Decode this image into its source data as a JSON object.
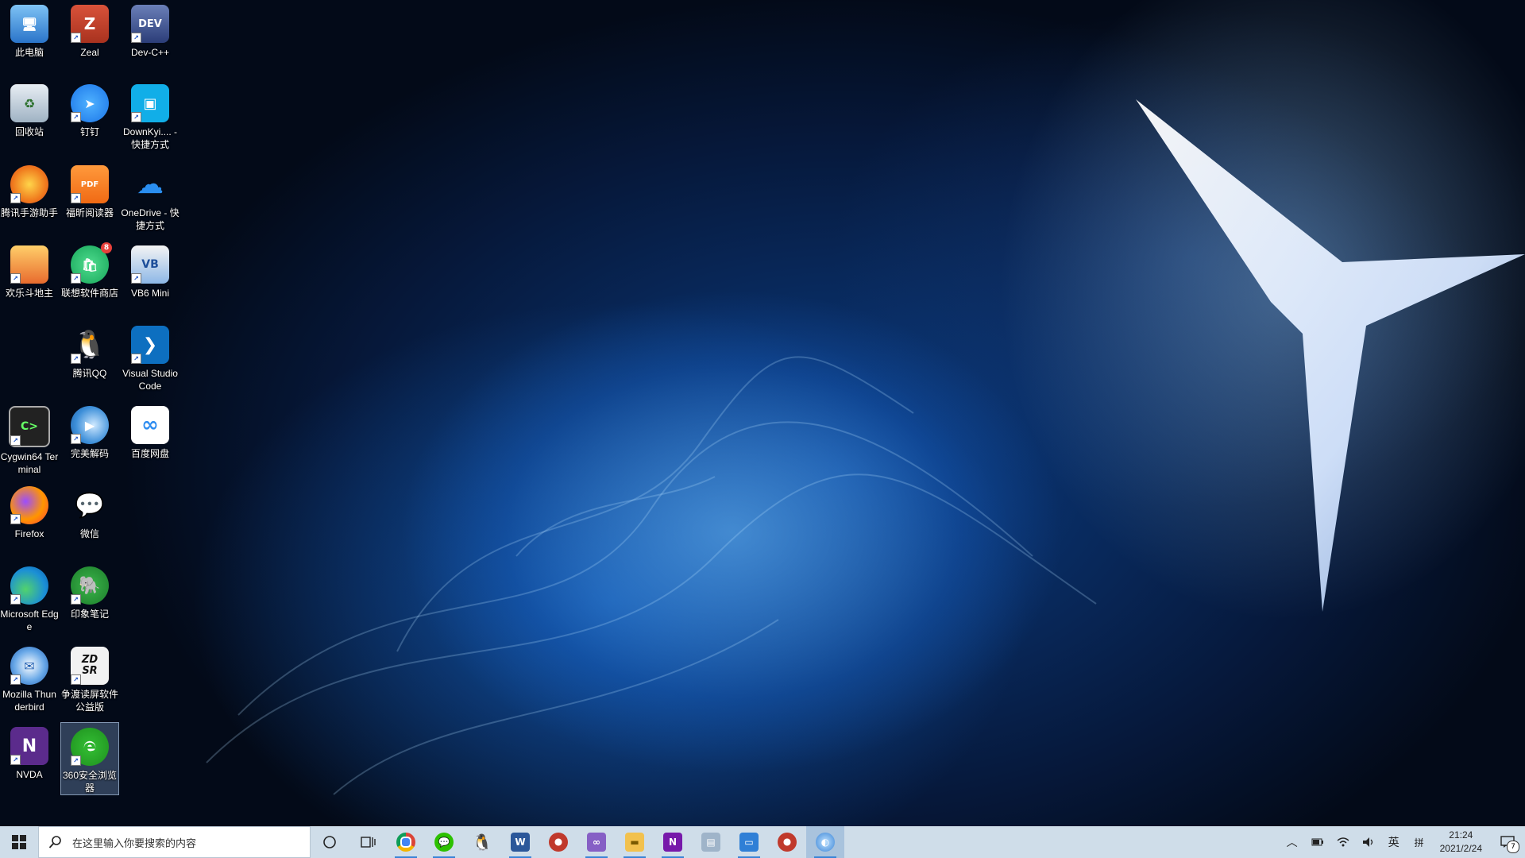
{
  "desktop": {
    "icons": [
      {
        "label": "此电脑",
        "icon": "computer-icon"
      },
      {
        "label": "Zeal",
        "icon": "zeal-icon"
      },
      {
        "label": "Dev-C++",
        "icon": "devcpp-icon"
      },
      {
        "label": "回收站",
        "icon": "recycle-bin-icon"
      },
      {
        "label": "钉钉",
        "icon": "dingtalk-icon"
      },
      {
        "label": "DownKyi.... - 快捷方式",
        "icon": "bilibili-icon"
      },
      {
        "label": "腾讯手游助手",
        "icon": "tencent-game-icon"
      },
      {
        "label": "福昕阅读器",
        "icon": "foxit-pdf-icon"
      },
      {
        "label": "OneDrive - 快捷方式",
        "icon": "onedrive-icon"
      },
      {
        "label": "欢乐斗地主",
        "icon": "doudizhu-icon"
      },
      {
        "label": "联想软件商店",
        "icon": "lenovo-store-icon"
      },
      {
        "label": "VB6 Mini",
        "icon": "vb6-icon"
      },
      {
        "label": "腾讯QQ",
        "icon": "qq-icon"
      },
      {
        "label": "Visual Studio Code",
        "icon": "vscode-icon"
      },
      {
        "label": "Cygwin64 Terminal",
        "icon": "cygwin-icon"
      },
      {
        "label": "完美解码",
        "icon": "potplayer-icon"
      },
      {
        "label": "百度网盘",
        "icon": "baidu-netdisk-icon"
      },
      {
        "label": "Firefox",
        "icon": "firefox-icon"
      },
      {
        "label": "微信",
        "icon": "wechat-icon"
      },
      {
        "label": "Microsoft Edge",
        "icon": "edge-icon"
      },
      {
        "label": "印象笔记",
        "icon": "evernote-icon"
      },
      {
        "label": "Mozilla Thunderbird",
        "icon": "thunderbird-icon"
      },
      {
        "label": "争渡读屏软件公益版",
        "icon": "zdsr-icon"
      },
      {
        "label": "NVDA",
        "icon": "nvda-icon"
      },
      {
        "label": "360安全浏览器",
        "icon": "360-browser-icon"
      }
    ],
    "store_badge": "8"
  },
  "taskbar": {
    "search_placeholder": "在这里输入你要搜索的内容",
    "apps": [
      {
        "icon": "chrome-icon",
        "color": "#db4437"
      },
      {
        "icon": "wechat-icon",
        "color": "#2dc100"
      },
      {
        "icon": "qq-icon",
        "color": "#111111"
      },
      {
        "icon": "word-icon",
        "color": "#2b579a"
      },
      {
        "icon": "app-red-icon",
        "color": "#c0392b"
      },
      {
        "icon": "visual-studio-icon",
        "color": "#865fc5"
      },
      {
        "icon": "file-explorer-icon",
        "color": "#f2c14e"
      },
      {
        "icon": "onenote-icon",
        "color": "#7719aa"
      },
      {
        "icon": "photos-icon",
        "color": "#6e8aa6"
      },
      {
        "icon": "remote-desktop-icon",
        "color": "#2f7fd6"
      },
      {
        "icon": "app-red2-icon",
        "color": "#c0392b"
      },
      {
        "icon": "active-app-icon",
        "color": "#3a84d6"
      }
    ],
    "tray": {
      "ime_label": "英",
      "ime_mode": "拼",
      "time": "21:24",
      "date": "2021/2/24",
      "notification_count": "7"
    }
  }
}
